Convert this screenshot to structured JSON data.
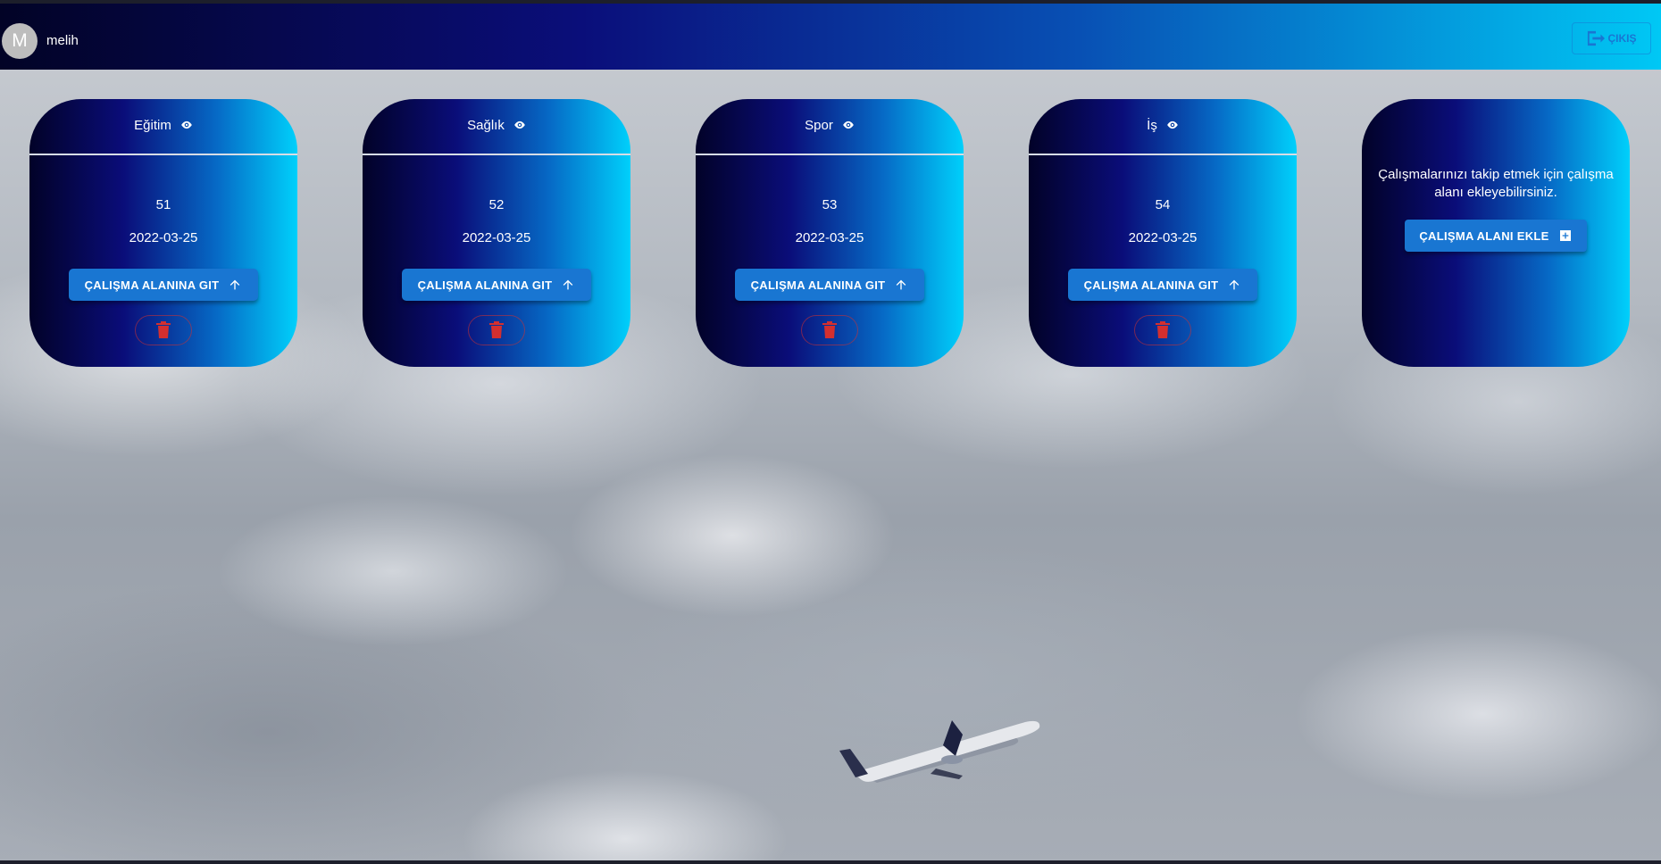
{
  "header": {
    "avatar_letter": "M",
    "username": "melih",
    "logout_label": "ÇIKIŞ"
  },
  "workspaces": [
    {
      "title": "Eğitim",
      "count": "51",
      "date": "2022-03-25",
      "go_label": "ÇALIŞMA ALANINA GIT"
    },
    {
      "title": "Sağlık",
      "count": "52",
      "date": "2022-03-25",
      "go_label": "ÇALIŞMA ALANINA GIT"
    },
    {
      "title": "Spor",
      "count": "53",
      "date": "2022-03-25",
      "go_label": "ÇALIŞMA ALANINA GIT"
    },
    {
      "title": "İş",
      "count": "54",
      "date": "2022-03-25",
      "go_label": "ÇALIŞMA ALANINA GIT"
    }
  ],
  "add_card": {
    "text": "Çalışmalarınızı takip etmek için çalışma alanı ekleyebilirsiniz.",
    "button_label": "ÇALIŞMA ALANI EKLE"
  },
  "colors": {
    "primary": "#1976d2",
    "danger": "#d32f2f",
    "gradient_start": "#020228",
    "gradient_end": "#00d0fb"
  },
  "icons": {
    "title": "eye-icon",
    "go": "arrow-up-icon",
    "delete": "trash-icon",
    "add": "add-box-icon",
    "logout": "logout-icon"
  }
}
